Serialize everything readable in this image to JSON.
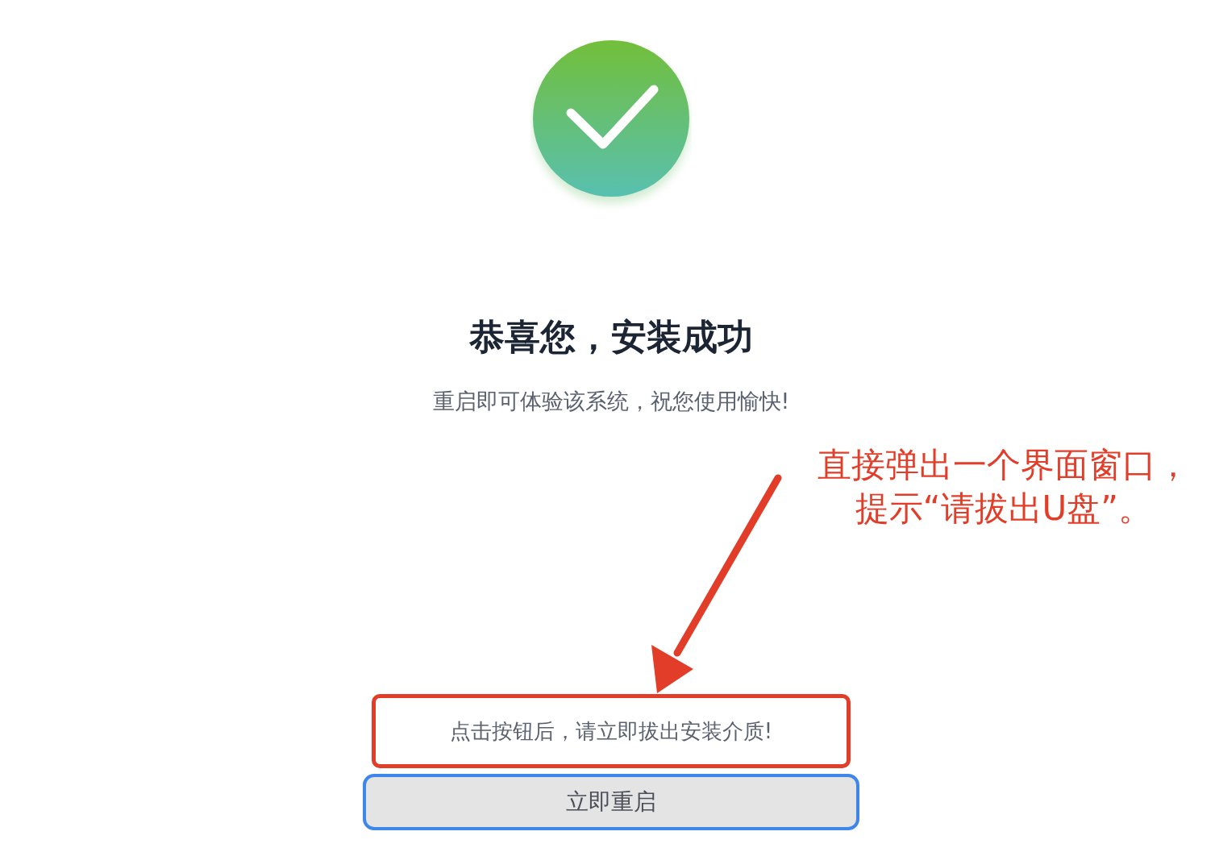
{
  "title": "恭喜您，安装成功",
  "subtitle": "重启即可体验该系统，祝您使用愉快!",
  "notice": "点击按钮后，请立即拔出安装介质!",
  "button": {
    "label": "立即重启",
    "focused": true
  },
  "annotation": {
    "lines": [
      "直接弹出一个界面窗口，",
      "提示“请拔出U盘”。"
    ]
  }
}
